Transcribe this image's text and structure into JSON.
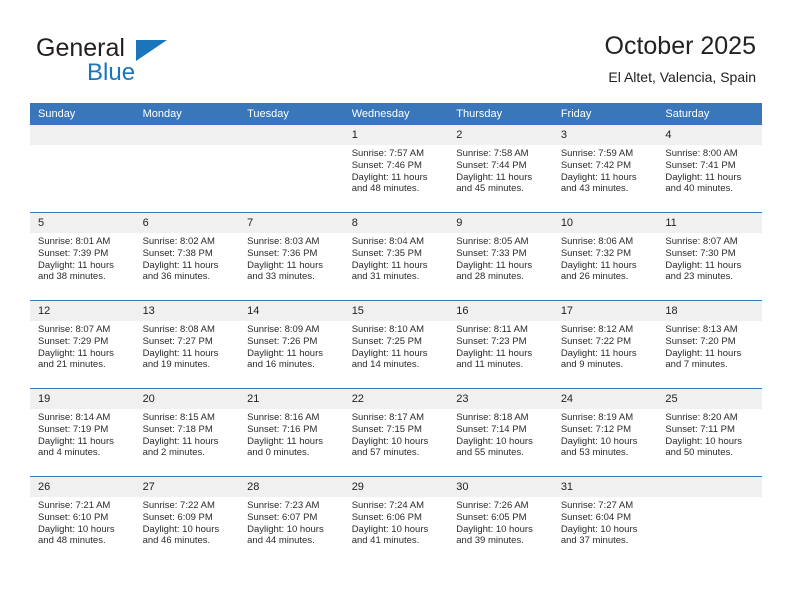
{
  "brand": {
    "line1": "General",
    "line2": "Blue",
    "accent_color": "#1b75bb"
  },
  "header": {
    "title": "October 2025",
    "location": "El Altet, Valencia, Spain"
  },
  "calendar": {
    "header_color": "#3a76ba",
    "daynum_band_color": "#f0f0f0",
    "weekday_headers": [
      "Sunday",
      "Monday",
      "Tuesday",
      "Wednesday",
      "Thursday",
      "Friday",
      "Saturday"
    ],
    "weeks": [
      [
        {
          "day": "",
          "empty": true
        },
        {
          "day": "",
          "empty": true
        },
        {
          "day": "",
          "empty": true
        },
        {
          "day": "1",
          "sunrise": "Sunrise: 7:57 AM",
          "sunset": "Sunset: 7:46 PM",
          "daylight_1": "Daylight: 11 hours",
          "daylight_2": "and 48 minutes."
        },
        {
          "day": "2",
          "sunrise": "Sunrise: 7:58 AM",
          "sunset": "Sunset: 7:44 PM",
          "daylight_1": "Daylight: 11 hours",
          "daylight_2": "and 45 minutes."
        },
        {
          "day": "3",
          "sunrise": "Sunrise: 7:59 AM",
          "sunset": "Sunset: 7:42 PM",
          "daylight_1": "Daylight: 11 hours",
          "daylight_2": "and 43 minutes."
        },
        {
          "day": "4",
          "sunrise": "Sunrise: 8:00 AM",
          "sunset": "Sunset: 7:41 PM",
          "daylight_1": "Daylight: 11 hours",
          "daylight_2": "and 40 minutes."
        }
      ],
      [
        {
          "day": "5",
          "sunrise": "Sunrise: 8:01 AM",
          "sunset": "Sunset: 7:39 PM",
          "daylight_1": "Daylight: 11 hours",
          "daylight_2": "and 38 minutes."
        },
        {
          "day": "6",
          "sunrise": "Sunrise: 8:02 AM",
          "sunset": "Sunset: 7:38 PM",
          "daylight_1": "Daylight: 11 hours",
          "daylight_2": "and 36 minutes."
        },
        {
          "day": "7",
          "sunrise": "Sunrise: 8:03 AM",
          "sunset": "Sunset: 7:36 PM",
          "daylight_1": "Daylight: 11 hours",
          "daylight_2": "and 33 minutes."
        },
        {
          "day": "8",
          "sunrise": "Sunrise: 8:04 AM",
          "sunset": "Sunset: 7:35 PM",
          "daylight_1": "Daylight: 11 hours",
          "daylight_2": "and 31 minutes."
        },
        {
          "day": "9",
          "sunrise": "Sunrise: 8:05 AM",
          "sunset": "Sunset: 7:33 PM",
          "daylight_1": "Daylight: 11 hours",
          "daylight_2": "and 28 minutes."
        },
        {
          "day": "10",
          "sunrise": "Sunrise: 8:06 AM",
          "sunset": "Sunset: 7:32 PM",
          "daylight_1": "Daylight: 11 hours",
          "daylight_2": "and 26 minutes."
        },
        {
          "day": "11",
          "sunrise": "Sunrise: 8:07 AM",
          "sunset": "Sunset: 7:30 PM",
          "daylight_1": "Daylight: 11 hours",
          "daylight_2": "and 23 minutes."
        }
      ],
      [
        {
          "day": "12",
          "sunrise": "Sunrise: 8:07 AM",
          "sunset": "Sunset: 7:29 PM",
          "daylight_1": "Daylight: 11 hours",
          "daylight_2": "and 21 minutes."
        },
        {
          "day": "13",
          "sunrise": "Sunrise: 8:08 AM",
          "sunset": "Sunset: 7:27 PM",
          "daylight_1": "Daylight: 11 hours",
          "daylight_2": "and 19 minutes."
        },
        {
          "day": "14",
          "sunrise": "Sunrise: 8:09 AM",
          "sunset": "Sunset: 7:26 PM",
          "daylight_1": "Daylight: 11 hours",
          "daylight_2": "and 16 minutes."
        },
        {
          "day": "15",
          "sunrise": "Sunrise: 8:10 AM",
          "sunset": "Sunset: 7:25 PM",
          "daylight_1": "Daylight: 11 hours",
          "daylight_2": "and 14 minutes."
        },
        {
          "day": "16",
          "sunrise": "Sunrise: 8:11 AM",
          "sunset": "Sunset: 7:23 PM",
          "daylight_1": "Daylight: 11 hours",
          "daylight_2": "and 11 minutes."
        },
        {
          "day": "17",
          "sunrise": "Sunrise: 8:12 AM",
          "sunset": "Sunset: 7:22 PM",
          "daylight_1": "Daylight: 11 hours",
          "daylight_2": "and 9 minutes."
        },
        {
          "day": "18",
          "sunrise": "Sunrise: 8:13 AM",
          "sunset": "Sunset: 7:20 PM",
          "daylight_1": "Daylight: 11 hours",
          "daylight_2": "and 7 minutes."
        }
      ],
      [
        {
          "day": "19",
          "sunrise": "Sunrise: 8:14 AM",
          "sunset": "Sunset: 7:19 PM",
          "daylight_1": "Daylight: 11 hours",
          "daylight_2": "and 4 minutes."
        },
        {
          "day": "20",
          "sunrise": "Sunrise: 8:15 AM",
          "sunset": "Sunset: 7:18 PM",
          "daylight_1": "Daylight: 11 hours",
          "daylight_2": "and 2 minutes."
        },
        {
          "day": "21",
          "sunrise": "Sunrise: 8:16 AM",
          "sunset": "Sunset: 7:16 PM",
          "daylight_1": "Daylight: 11 hours",
          "daylight_2": "and 0 minutes."
        },
        {
          "day": "22",
          "sunrise": "Sunrise: 8:17 AM",
          "sunset": "Sunset: 7:15 PM",
          "daylight_1": "Daylight: 10 hours",
          "daylight_2": "and 57 minutes."
        },
        {
          "day": "23",
          "sunrise": "Sunrise: 8:18 AM",
          "sunset": "Sunset: 7:14 PM",
          "daylight_1": "Daylight: 10 hours",
          "daylight_2": "and 55 minutes."
        },
        {
          "day": "24",
          "sunrise": "Sunrise: 8:19 AM",
          "sunset": "Sunset: 7:12 PM",
          "daylight_1": "Daylight: 10 hours",
          "daylight_2": "and 53 minutes."
        },
        {
          "day": "25",
          "sunrise": "Sunrise: 8:20 AM",
          "sunset": "Sunset: 7:11 PM",
          "daylight_1": "Daylight: 10 hours",
          "daylight_2": "and 50 minutes."
        }
      ],
      [
        {
          "day": "26",
          "sunrise": "Sunrise: 7:21 AM",
          "sunset": "Sunset: 6:10 PM",
          "daylight_1": "Daylight: 10 hours",
          "daylight_2": "and 48 minutes."
        },
        {
          "day": "27",
          "sunrise": "Sunrise: 7:22 AM",
          "sunset": "Sunset: 6:09 PM",
          "daylight_1": "Daylight: 10 hours",
          "daylight_2": "and 46 minutes."
        },
        {
          "day": "28",
          "sunrise": "Sunrise: 7:23 AM",
          "sunset": "Sunset: 6:07 PM",
          "daylight_1": "Daylight: 10 hours",
          "daylight_2": "and 44 minutes."
        },
        {
          "day": "29",
          "sunrise": "Sunrise: 7:24 AM",
          "sunset": "Sunset: 6:06 PM",
          "daylight_1": "Daylight: 10 hours",
          "daylight_2": "and 41 minutes."
        },
        {
          "day": "30",
          "sunrise": "Sunrise: 7:26 AM",
          "sunset": "Sunset: 6:05 PM",
          "daylight_1": "Daylight: 10 hours",
          "daylight_2": "and 39 minutes."
        },
        {
          "day": "31",
          "sunrise": "Sunrise: 7:27 AM",
          "sunset": "Sunset: 6:04 PM",
          "daylight_1": "Daylight: 10 hours",
          "daylight_2": "and 37 minutes."
        },
        {
          "day": "",
          "empty": true
        }
      ]
    ]
  }
}
